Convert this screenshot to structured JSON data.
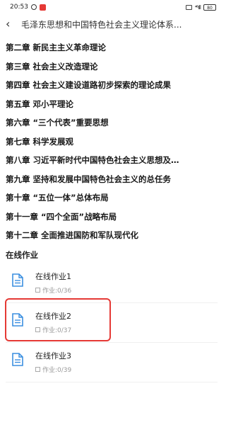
{
  "status_bar": {
    "time": "20:53",
    "signal": "⁴⁶ıll",
    "battery": "80"
  },
  "header": {
    "title": "毛泽东思想和中国特色社会主义理论体系..."
  },
  "chapters": [
    "第二章 新民主主义革命理论",
    "第三章 社会主义改造理论",
    "第四章 社会主义建设道路初步探索的理论成果",
    "第五章 邓小平理论",
    "第六章 “三个代表”重要思想",
    "第七章 科学发展观",
    "第八章 习近平新时代中国特色社会主义思想及…",
    "第九章 坚持和发展中国特色社会主义的总任务",
    "第十章 “五位一体”总体布局",
    "第十一章 “四个全面”战略布局",
    "第十二章 全面推进国防和军队现代化"
  ],
  "online_homework": {
    "section_title": "在线作业",
    "items": [
      {
        "title": "在线作业1",
        "meta": "作业:0/36"
      },
      {
        "title": "在线作业2",
        "meta": "作业:0/37"
      },
      {
        "title": "在线作业3",
        "meta": "作业:0/39"
      }
    ]
  },
  "colors": {
    "accent": "#3b8fe0",
    "highlight": "#e53935"
  }
}
